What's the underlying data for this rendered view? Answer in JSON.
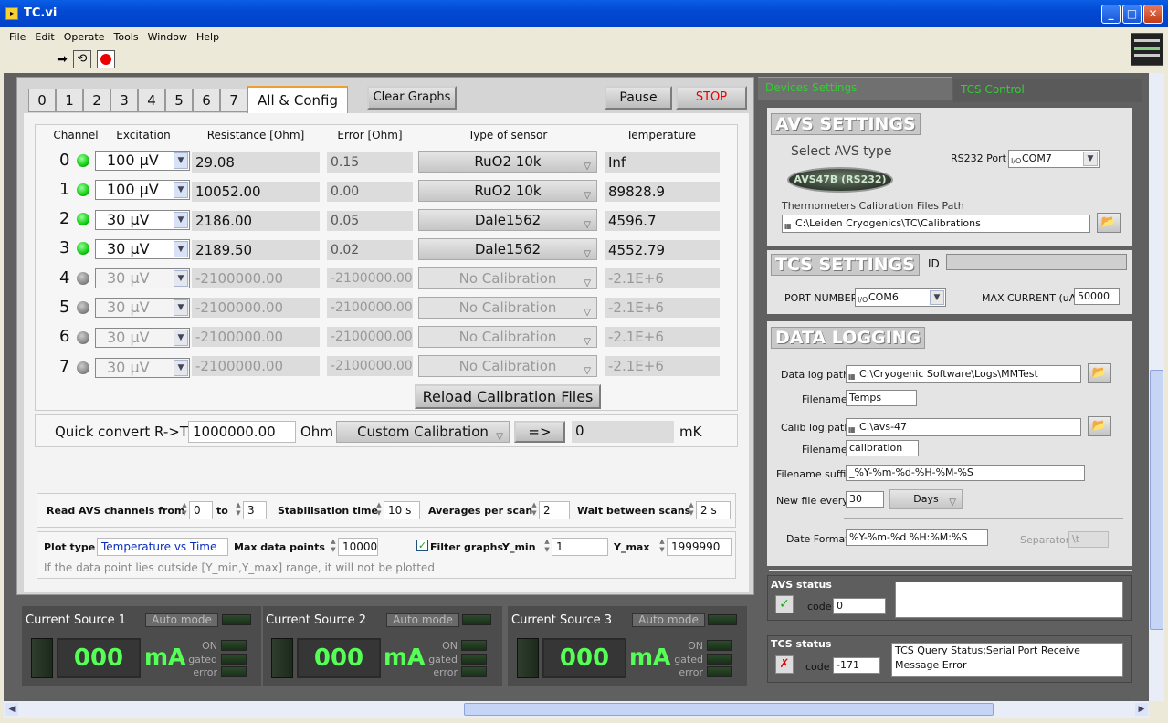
{
  "window": {
    "title": "TC.vi",
    "minimize": "_",
    "maximize": "□",
    "close": "✕"
  },
  "menu": [
    "File",
    "Edit",
    "Operate",
    "Tools",
    "Window",
    "Help"
  ],
  "tabs": [
    "0",
    "1",
    "2",
    "3",
    "4",
    "5",
    "6",
    "7",
    "All & Config"
  ],
  "buttons": {
    "clear": "Clear Graphs",
    "pause": "Pause",
    "stop": "STOP",
    "reload": "Reload Calibration Files",
    "convert": "=>"
  },
  "headers": {
    "channel": "Channel",
    "excitation": "Excitation",
    "resistance": "Resistance [Ohm]",
    "error": "Error [Ohm]",
    "sensor": "Type of sensor",
    "temperature": "Temperature"
  },
  "channels": [
    {
      "num": "0",
      "excitation": "100 µV",
      "resistance": "29.08",
      "error": "0.15",
      "sensor": "RuO2 10k",
      "temp": "Inf"
    },
    {
      "num": "1",
      "excitation": "100 µV",
      "resistance": "10052.00",
      "error": "0.00",
      "sensor": "RuO2 10k",
      "temp": "89828.9"
    },
    {
      "num": "2",
      "excitation": "30 µV",
      "resistance": "2186.00",
      "error": "0.05",
      "sensor": "Dale1562",
      "temp": "4596.7"
    },
    {
      "num": "3",
      "excitation": "30 µV",
      "resistance": "2189.50",
      "error": "0.02",
      "sensor": "Dale1562",
      "temp": "4552.79"
    },
    {
      "num": "4",
      "excitation": "30 µV",
      "resistance": "-2100000.00",
      "error": "-2100000.00",
      "sensor": "No Calibration",
      "temp": "-2.1E+6"
    },
    {
      "num": "5",
      "excitation": "30 µV",
      "resistance": "-2100000.00",
      "error": "-2100000.00",
      "sensor": "No Calibration",
      "temp": "-2.1E+6"
    },
    {
      "num": "6",
      "excitation": "30 µV",
      "resistance": "-2100000.00",
      "error": "-2100000.00",
      "sensor": "No Calibration",
      "temp": "-2.1E+6"
    },
    {
      "num": "7",
      "excitation": "30 µV",
      "resistance": "-2100000.00",
      "error": "-2100000.00",
      "sensor": "No Calibration",
      "temp": "-2.1E+6"
    }
  ],
  "quick": {
    "label": "Quick convert R->T:",
    "value": "1000000.00",
    "unit": "Ohm",
    "calibration": "Custom Calibration",
    "result": "0",
    "result_unit": "mK"
  },
  "read": {
    "label": "Read AVS channels from",
    "from": "0",
    "to_label": "to",
    "to": "3",
    "stab_label": "Stabilisation time",
    "stab": "10 s",
    "avg_label": "Averages per scan",
    "avg": "2",
    "wait_label": "Wait between scans",
    "wait": "2 s"
  },
  "plot": {
    "type_label": "Plot type",
    "type": "Temperature vs Time",
    "max_label": "Max data  points",
    "max": "10000",
    "filter_label": "Filter graphs:",
    "ymin_label": "Y_min",
    "ymin": "1",
    "ymax_label": "Y_max",
    "ymax": "1999990",
    "note": "If the data point lies outside [Y_min,Y_max] range, it will not be plotted"
  },
  "sources": [
    {
      "title": "Current Source 1",
      "auto": "Auto mode",
      "value": "000",
      "unit": "mA",
      "on": "ON",
      "gated": "gated",
      "error": "error"
    },
    {
      "title": "Current Source 2",
      "auto": "Auto mode",
      "value": "000",
      "unit": "mA",
      "on": "ON",
      "gated": "gated",
      "error": "error"
    },
    {
      "title": "Current Source 3",
      "auto": "Auto mode",
      "value": "000",
      "unit": "mA",
      "on": "ON",
      "gated": "gated",
      "error": "error"
    }
  ],
  "right_tabs": [
    "Devices Settings",
    "TCS Control"
  ],
  "avs": {
    "title": "AVS SETTINGS",
    "select_label": "Select AVS type",
    "type": "AVS47B (RS232)",
    "port_label": "RS232 Port",
    "port": "COM7",
    "calib_label": "Thermometers Calibration Files Path",
    "calib_path": "C:\\Leiden Cryogenics\\TC\\Calibrations"
  },
  "tcs": {
    "title": "TCS SETTINGS",
    "id_label": "ID",
    "port_label": "PORT NUMBER",
    "port": "COM6",
    "max_label": "MAX CURRENT (uA)",
    "max": "50000"
  },
  "log": {
    "title": "DATA LOGGING",
    "path_label": "Data log path",
    "path": "C:\\Cryogenic Software\\Logs\\MMTest",
    "fname_label": "Filename",
    "fname": "Temps",
    "calib_label": "Calib log path",
    "calib_path": "C:\\avs-47",
    "cfname_label": "Filename",
    "cfname": "calibration",
    "suffix_label": "Filename suffix",
    "suffix": "_%Y-%m-%d-%H-%M-%S",
    "every_label": "New file every",
    "every": "30",
    "every_unit": "Days",
    "date_label": "Date Format",
    "date": "%Y-%m-%d %H:%M:%S",
    "sep_label": "Separator",
    "sep": "\\t"
  },
  "avs_status": {
    "title": "AVS status",
    "code_label": "code",
    "code": "0",
    "message": ""
  },
  "tcs_status": {
    "title": "TCS status",
    "code_label": "code",
    "code": "-171",
    "message": "TCS Query Status;Serial Port Receive Message Error"
  }
}
